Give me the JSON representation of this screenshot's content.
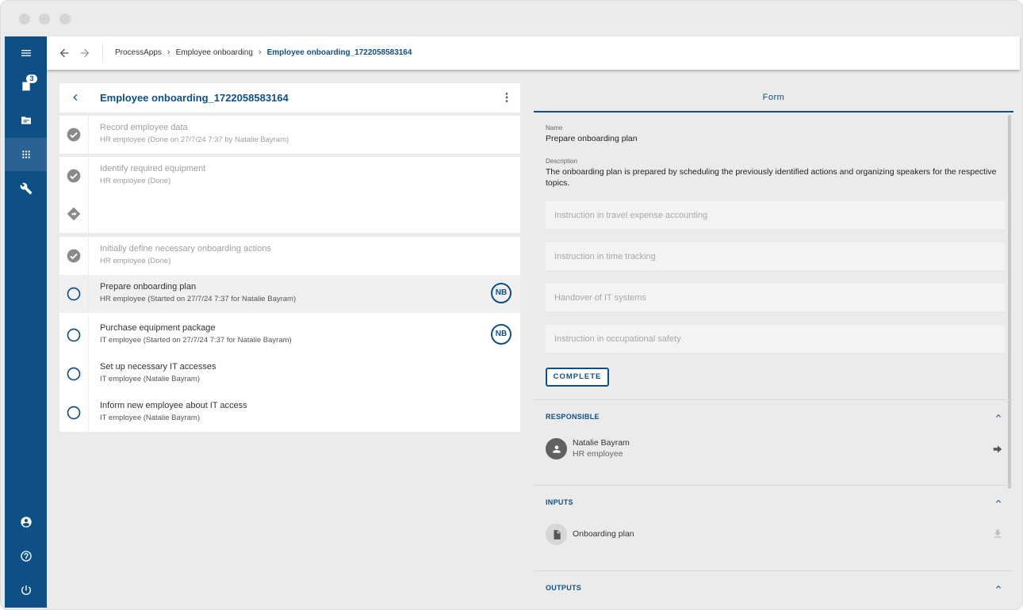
{
  "topbar": {
    "breadcrumb": [
      "ProcessApps",
      "Employee onboarding",
      "Employee onboarding_1722058583164"
    ]
  },
  "sidebar": {
    "items": [
      {
        "icon": "menu-icon"
      },
      {
        "icon": "task-list-icon",
        "badge": "3"
      },
      {
        "icon": "folder-icon"
      },
      {
        "icon": "apps-grid-icon",
        "active": true
      },
      {
        "icon": "wrench-icon"
      }
    ],
    "bottom": [
      {
        "icon": "account-icon"
      },
      {
        "icon": "help-icon"
      },
      {
        "icon": "power-icon"
      }
    ]
  },
  "instance": {
    "title": "Employee onboarding_1722058583164",
    "tasks": [
      {
        "title": "Record employee data",
        "sub": "HR employee (Done on 27/7/24 7:37 by Natalie Bayram)",
        "status": "done"
      },
      {
        "title": "Identify required equipment",
        "sub": "HR employee (Done)",
        "status": "done"
      },
      {
        "title": "",
        "sub": "",
        "status": "gateway"
      },
      {
        "title": "Initially define necessary onboarding actions",
        "sub": "HR employee (Done)",
        "status": "done"
      },
      {
        "title": "Prepare onboarding plan",
        "sub": "HR employee (Started on 27/7/24 7:37 for Natalie Bayram)",
        "status": "open",
        "assignee": "NB"
      },
      {
        "title": "Purchase equipment package",
        "sub": "IT employee (Started on 27/7/24 7:37 for Natalie Bayram)",
        "status": "open",
        "assignee": "NB"
      },
      {
        "title": "Set up necessary IT accesses",
        "sub": "IT employee (Natalie Bayram)",
        "status": "open"
      },
      {
        "title": "Inform new employee about IT access",
        "sub": "IT employee (Natalie Bayram)",
        "status": "open"
      }
    ]
  },
  "form": {
    "tab_label": "Form",
    "name_label": "Name",
    "name_value": "Prepare onboarding plan",
    "description_label": "Description",
    "description_value": "The onboarding plan is prepared by scheduling the previously identified actions and organizing speakers for the respective topics.",
    "fields": [
      {
        "placeholder": "Instruction in travel expense accounting"
      },
      {
        "placeholder": "Instruction in time tracking"
      },
      {
        "placeholder": "Handover of IT systems"
      },
      {
        "placeholder": "Instruction in occupational safety"
      }
    ],
    "complete_label": "COMPLETE"
  },
  "responsible": {
    "title": "RESPONSIBLE",
    "name": "Natalie Bayram",
    "role": "HR employee"
  },
  "inputs": {
    "title": "INPUTS",
    "item": "Onboarding plan"
  },
  "outputs": {
    "title": "OUTPUTS"
  },
  "colors": {
    "brand": "#0e5085",
    "sidebar_active": "#2a6393",
    "done_icon": "#8a8a8a"
  }
}
